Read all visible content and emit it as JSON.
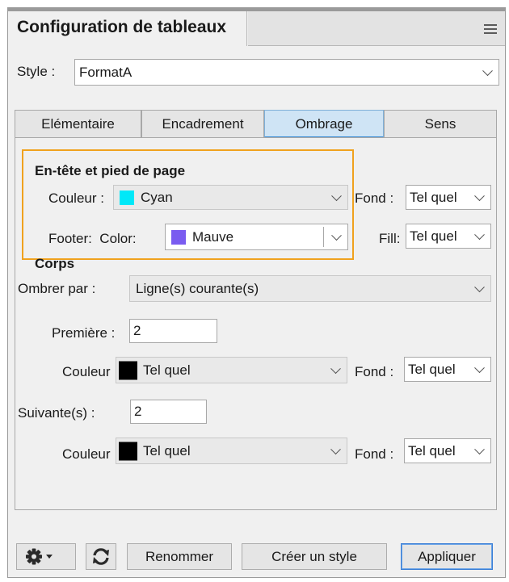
{
  "panel": {
    "title": "Configuration de tableaux",
    "menu_icon": "hamburger-menu-icon"
  },
  "style": {
    "label": "Style :",
    "value": "FormatA"
  },
  "tabs": [
    {
      "label": "Elémentaire",
      "active": false
    },
    {
      "label": "Encadrement",
      "active": false
    },
    {
      "label": "Ombrage",
      "active": true
    },
    {
      "label": "Sens",
      "active": false
    }
  ],
  "header_footer": {
    "heading": "En-tête et pied de page",
    "header": {
      "color_label": "Couleur :",
      "color_value": "Cyan",
      "swatch": "#00e8f8",
      "fill_label": "Fond :",
      "fill_value": "Tel quel"
    },
    "footer": {
      "color_label": "Footer:  Color:",
      "color_value": "Mauve",
      "swatch": "#7a5cf0",
      "fill_label": "Fill:",
      "fill_value": "Tel quel"
    }
  },
  "body": {
    "heading": "Corps",
    "shade_by_label": "Ombrer par :",
    "shade_by_value": "Ligne(s) courante(s)",
    "first": {
      "label": "Première :",
      "value": "2",
      "color_label": "Couleur",
      "color_value": "Tel quel",
      "swatch": "#000000",
      "fill_label": "Fond :",
      "fill_value": "Tel quel"
    },
    "next": {
      "label": "Suivante(s) :",
      "value": "2",
      "color_label": "Couleur",
      "color_value": "Tel quel",
      "swatch": "#000000",
      "fill_label": "Fond :",
      "fill_value": "Tel quel"
    }
  },
  "footer_buttons": {
    "settings_icon": "gear-dropdown-icon",
    "refresh_icon": "refresh-icon",
    "rename": "Renommer",
    "create": "Créer un style",
    "apply": "Appliquer"
  }
}
